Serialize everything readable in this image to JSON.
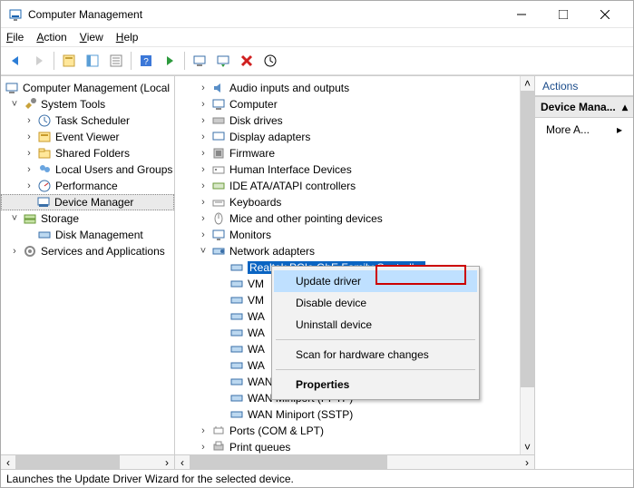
{
  "titlebar": {
    "title": "Computer Management"
  },
  "menubar": {
    "file": "File",
    "action": "Action",
    "view": "View",
    "help": "Help"
  },
  "left_tree": {
    "root": "Computer Management (Local",
    "items": [
      "System Tools",
      "Task Scheduler",
      "Event Viewer",
      "Shared Folders",
      "Local Users and Groups",
      "Performance",
      "Device Manager",
      "Storage",
      "Disk Management",
      "Services and Applications"
    ]
  },
  "mid_tree": {
    "items": [
      "Audio inputs and outputs",
      "Computer",
      "Disk drives",
      "Display adapters",
      "Firmware",
      "Human Interface Devices",
      "IDE ATA/ATAPI controllers",
      "Keyboards",
      "Mice and other pointing devices",
      "Monitors",
      "Network adapters"
    ],
    "net_selected": "Realtek PCIe GbE Family Controller",
    "net_items": [
      "VM",
      "VM",
      "WA",
      "WA",
      "WA",
      "WA"
    ],
    "wan_items": [
      "WAN Miniport (PPPOE)",
      "WAN Miniport (PPTP)",
      "WAN Miniport (SSTP)"
    ],
    "tail_items": [
      "Ports (COM & LPT)",
      "Print queues"
    ]
  },
  "context_menu": {
    "update": "Update driver",
    "disable": "Disable device",
    "uninstall": "Uninstall device",
    "scan": "Scan for hardware changes",
    "properties": "Properties"
  },
  "actions_panel": {
    "header": "Actions",
    "sub": "Device Mana...",
    "more": "More A..."
  },
  "status": "Launches the Update Driver Wizard for the selected device."
}
